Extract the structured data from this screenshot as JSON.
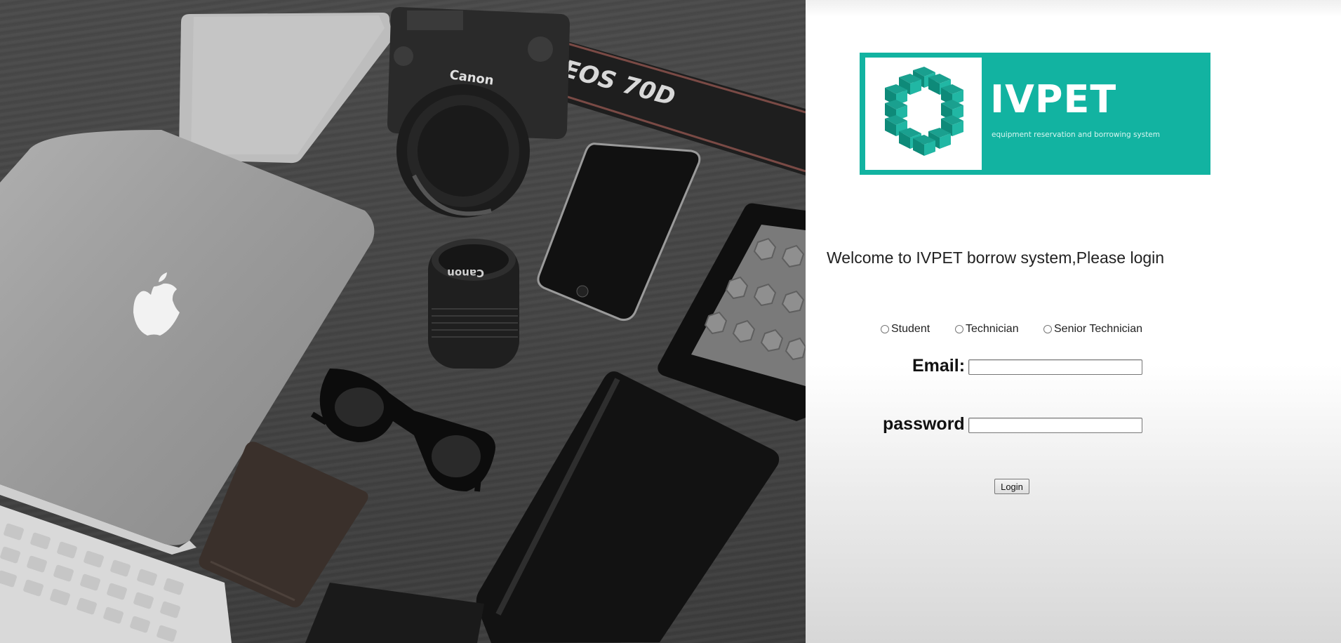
{
  "logo": {
    "brand": "IVPET",
    "tagline": "equipment reservation and borrowing system",
    "colors": {
      "background": "#12b3a1",
      "cube": "#1aa08f"
    }
  },
  "welcome_text": "Welcome to IVPET borrow system,Please login",
  "roles": {
    "options": [
      "Student",
      "Technician",
      "Senior Technician"
    ],
    "selected": ""
  },
  "form": {
    "email_label": "Email:",
    "email_value": "",
    "password_label": "password",
    "password_value": "",
    "login_label": "Login"
  },
  "photo": {
    "description_icons": [
      "laptop-icon",
      "camera-icon",
      "lens-icon",
      "phone-icon",
      "ereader-icon",
      "sunglasses-icon",
      "notebook-icon",
      "wallet-icon",
      "keyboard-icon"
    ],
    "camera_strap_text": "EOS 70D",
    "camera_brand_text": "Canon"
  }
}
